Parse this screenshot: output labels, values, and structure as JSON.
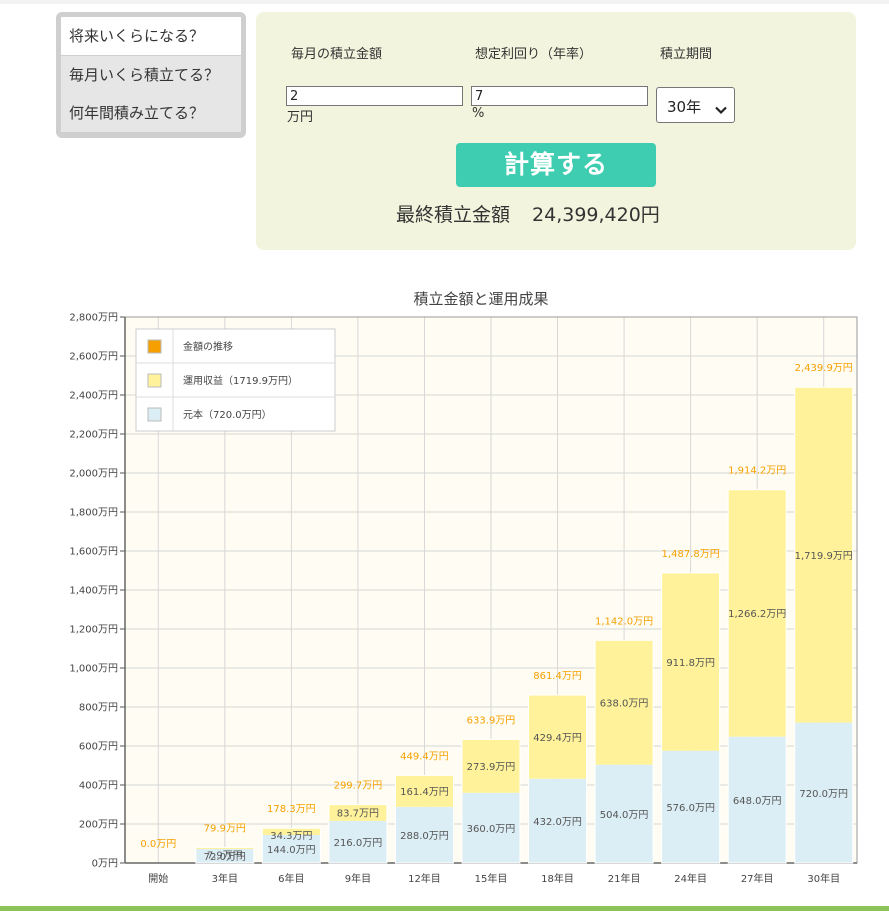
{
  "tabs": [
    {
      "label": "将来いくらになる？"
    },
    {
      "label": "毎月いくら積立てる？"
    },
    {
      "label": "何年間積み立てる？"
    }
  ],
  "form": {
    "monthly_label": "毎月の積立金額",
    "rate_label": "想定利回り（年率）",
    "period_label": "積立期間",
    "monthly_value": "2",
    "monthly_unit": "万円",
    "rate_value": "7",
    "rate_unit": "%",
    "period_value": "30年",
    "calc_button": "計算する",
    "result_label": "最終積立金額",
    "result_value": "24,399,420円"
  },
  "colors": {
    "total": "#f5a000",
    "gain": "#fff29a",
    "principal": "#dceef5",
    "button": "#3ecdb0",
    "panel": "#f3f4dd"
  },
  "chart_data": {
    "type": "bar",
    "title": "積立金額と運用成果",
    "categories": [
      "開始",
      "3年目",
      "6年目",
      "9年目",
      "12年目",
      "15年目",
      "18年目",
      "21年目",
      "24年目",
      "27年目",
      "30年目"
    ],
    "series": [
      {
        "name": "元本（720.0万円）",
        "values": [
          0,
          72.0,
          144.0,
          216.0,
          288.0,
          360.0,
          432.0,
          504.0,
          576.0,
          648.0,
          720.0
        ],
        "labels": [
          "",
          "72.0万円",
          "144.0万円",
          "216.0万円",
          "288.0万円",
          "360.0万円",
          "432.0万円",
          "504.0万円",
          "576.0万円",
          "648.0万円",
          "720.0万円"
        ]
      },
      {
        "name": "運用収益（1719.9万円）",
        "values": [
          0,
          7.9,
          34.3,
          83.7,
          161.4,
          273.9,
          429.4,
          638.0,
          911.8,
          1266.2,
          1719.9
        ],
        "labels": [
          "",
          "7.9万円",
          "34.3万円",
          "83.7万円",
          "161.4万円",
          "273.9万円",
          "429.4万円",
          "638.0万円",
          "911.8万円",
          "1,266.2万円",
          "1,719.9万円"
        ]
      },
      {
        "name": "金額の推移",
        "values": [
          0,
          79.9,
          178.3,
          299.7,
          449.4,
          633.9,
          861.4,
          1142.0,
          1487.8,
          1914.2,
          2439.9
        ],
        "labels": [
          "0.0万円",
          "79.9万円",
          "178.3万円",
          "299.7万円",
          "449.4万円",
          "633.9万円",
          "861.4万円",
          "1,142.0万円",
          "1,487.8万円",
          "1,914.2万円",
          "2,439.9万円"
        ]
      }
    ],
    "yticks": [
      "0万円",
      "200万円",
      "400万円",
      "600万円",
      "800万円",
      "1,000万円",
      "1,200万円",
      "1,400万円",
      "1,600万円",
      "1,800万円",
      "2,000万円",
      "2,200万円",
      "2,400万円",
      "2,600万円",
      "2,800万円"
    ],
    "ylim": [
      0,
      2800
    ],
    "grid": true,
    "legend": "top-left"
  }
}
